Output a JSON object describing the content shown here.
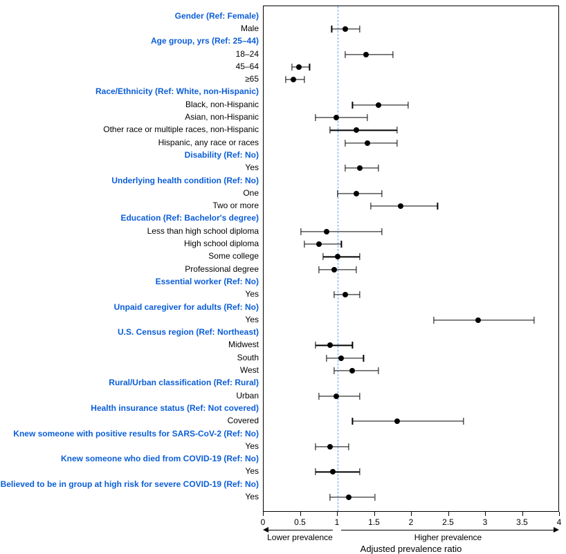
{
  "chart_data": {
    "type": "scatter",
    "title": "",
    "xlabel": "Adjusted prevalence ratio",
    "xlim": [
      0,
      4
    ],
    "xticks": [
      0,
      0.5,
      1,
      1.5,
      2,
      2.5,
      3,
      3.5,
      4
    ],
    "reference_line": 1,
    "annotation_lower": "Lower prevalence",
    "annotation_higher": "Higher prevalence",
    "rows": [
      {
        "type": "header",
        "label": "Gender (Ref: Female)"
      },
      {
        "type": "item",
        "label": "Male",
        "pr": 1.1,
        "lo": 0.92,
        "hi": 1.3
      },
      {
        "type": "header",
        "label": "Age group, yrs (Ref: 25–44)"
      },
      {
        "type": "item",
        "label": "18–24",
        "pr": 1.38,
        "lo": 1.1,
        "hi": 1.75
      },
      {
        "type": "item",
        "label": "45–64",
        "pr": 0.48,
        "lo": 0.38,
        "hi": 0.62
      },
      {
        "type": "item",
        "label": "≥65",
        "pr": 0.4,
        "lo": 0.3,
        "hi": 0.55
      },
      {
        "type": "header",
        "label": "Race/Ethnicity (Ref:  White, non-Hispanic)"
      },
      {
        "type": "item",
        "label": "Black, non-Hispanic",
        "pr": 1.55,
        "lo": 1.2,
        "hi": 1.95
      },
      {
        "type": "item",
        "label": "Asian, non-Hispanic",
        "pr": 0.98,
        "lo": 0.7,
        "hi": 1.4
      },
      {
        "type": "item",
        "label": "Other race or multiple races, non-Hispanic",
        "pr": 1.25,
        "lo": 0.9,
        "hi": 1.8
      },
      {
        "type": "item",
        "label": "Hispanic, any race or races",
        "pr": 1.4,
        "lo": 1.1,
        "hi": 1.8
      },
      {
        "type": "header",
        "label": "Disability (Ref: No)"
      },
      {
        "type": "item",
        "label": "Yes",
        "pr": 1.3,
        "lo": 1.1,
        "hi": 1.55
      },
      {
        "type": "header",
        "label": "Underlying health condition (Ref: No)"
      },
      {
        "type": "item",
        "label": "One",
        "pr": 1.25,
        "lo": 1.0,
        "hi": 1.6
      },
      {
        "type": "item",
        "label": "Two or more",
        "pr": 1.85,
        "lo": 1.45,
        "hi": 2.35
      },
      {
        "type": "header",
        "label": "Education (Ref: Bachelor's degree)"
      },
      {
        "type": "item",
        "label": "Less than high school diploma",
        "pr": 0.85,
        "lo": 0.5,
        "hi": 1.6
      },
      {
        "type": "item",
        "label": "High school diploma",
        "pr": 0.75,
        "lo": 0.55,
        "hi": 1.05
      },
      {
        "type": "item",
        "label": "Some college",
        "pr": 1.0,
        "lo": 0.8,
        "hi": 1.3
      },
      {
        "type": "item",
        "label": "Professional degree",
        "pr": 0.95,
        "lo": 0.75,
        "hi": 1.25
      },
      {
        "type": "header",
        "label": "Essential worker (Ref: No)"
      },
      {
        "type": "item",
        "label": "Yes",
        "pr": 1.1,
        "lo": 0.95,
        "hi": 1.3
      },
      {
        "type": "header",
        "label": "Unpaid caregiver for adults (Ref: No)"
      },
      {
        "type": "item",
        "label": "Yes",
        "pr": 2.9,
        "lo": 2.3,
        "hi": 3.65
      },
      {
        "type": "header",
        "label": "U.S. Census region (Ref: Northeast)"
      },
      {
        "type": "item",
        "label": "Midwest",
        "pr": 0.9,
        "lo": 0.7,
        "hi": 1.2
      },
      {
        "type": "item",
        "label": "South",
        "pr": 1.05,
        "lo": 0.85,
        "hi": 1.35
      },
      {
        "type": "item",
        "label": "West",
        "pr": 1.2,
        "lo": 0.95,
        "hi": 1.55
      },
      {
        "type": "header",
        "label": "Rural/Urban classification (Ref: Rural)"
      },
      {
        "type": "item",
        "label": "Urban",
        "pr": 0.98,
        "lo": 0.75,
        "hi": 1.3
      },
      {
        "type": "header",
        "label": "Health insurance status (Ref: Not covered)"
      },
      {
        "type": "item",
        "label": "Covered",
        "pr": 1.8,
        "lo": 1.2,
        "hi": 2.7
      },
      {
        "type": "header",
        "label": "Knew someone with positive results for SARS-CoV-2 (Ref: No)"
      },
      {
        "type": "item",
        "label": "Yes",
        "pr": 0.9,
        "lo": 0.7,
        "hi": 1.15
      },
      {
        "type": "header",
        "label": "Knew someone who died from COVID-19 (Ref: No)"
      },
      {
        "type": "item",
        "label": "Yes",
        "pr": 0.93,
        "lo": 0.7,
        "hi": 1.3
      },
      {
        "type": "header",
        "label": "Believed to be in group at high risk for severe COVID-19 (Ref: No)"
      },
      {
        "type": "item",
        "label": "Yes",
        "pr": 1.15,
        "lo": 0.9,
        "hi": 1.5
      }
    ]
  }
}
